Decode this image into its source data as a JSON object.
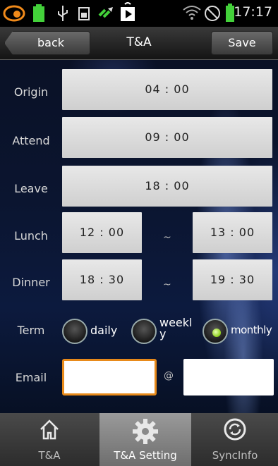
{
  "status_bar": {
    "time": "17:17",
    "left_icons": [
      "app-icon",
      "battery-full-icon",
      "usb-icon",
      "sd-card-icon",
      "sync-icon",
      "play-store-icon"
    ],
    "right_icons": [
      "wifi-icon",
      "blocked-icon",
      "battery-icon"
    ]
  },
  "titlebar": {
    "back_label": "back",
    "title": "T&A",
    "save_label": "Save"
  },
  "form": {
    "origin": {
      "label": "Origin",
      "value": "04 : 00"
    },
    "attend": {
      "label": "Attend",
      "value": "09 : 00"
    },
    "leave": {
      "label": "Leave",
      "value": "18 : 00"
    },
    "lunch": {
      "label": "Lunch",
      "start": "12 : 00",
      "end": "13 : 00",
      "separator": "~"
    },
    "dinner": {
      "label": "Dinner",
      "start": "18 : 30",
      "end": "19 : 30",
      "separator": "~"
    },
    "term": {
      "label": "Term",
      "options": [
        {
          "label": "daily",
          "selected": false
        },
        {
          "label": "weekl\ny",
          "selected": false
        },
        {
          "label": "monthly",
          "selected": true
        }
      ]
    },
    "email": {
      "label": "Email",
      "user_value": "",
      "at": "@",
      "domain_value": ""
    }
  },
  "tabs": [
    {
      "label": "T&A",
      "icon": "home-icon",
      "active": false
    },
    {
      "label": "T&A Setting",
      "icon": "gear-icon",
      "active": true
    },
    {
      "label": "SyncInfo",
      "icon": "sync-icon",
      "active": false
    }
  ],
  "colors": {
    "email_focus_border": "#e88a1a",
    "radio_selected": "#8ccf1a",
    "battery": "#43d13a"
  }
}
